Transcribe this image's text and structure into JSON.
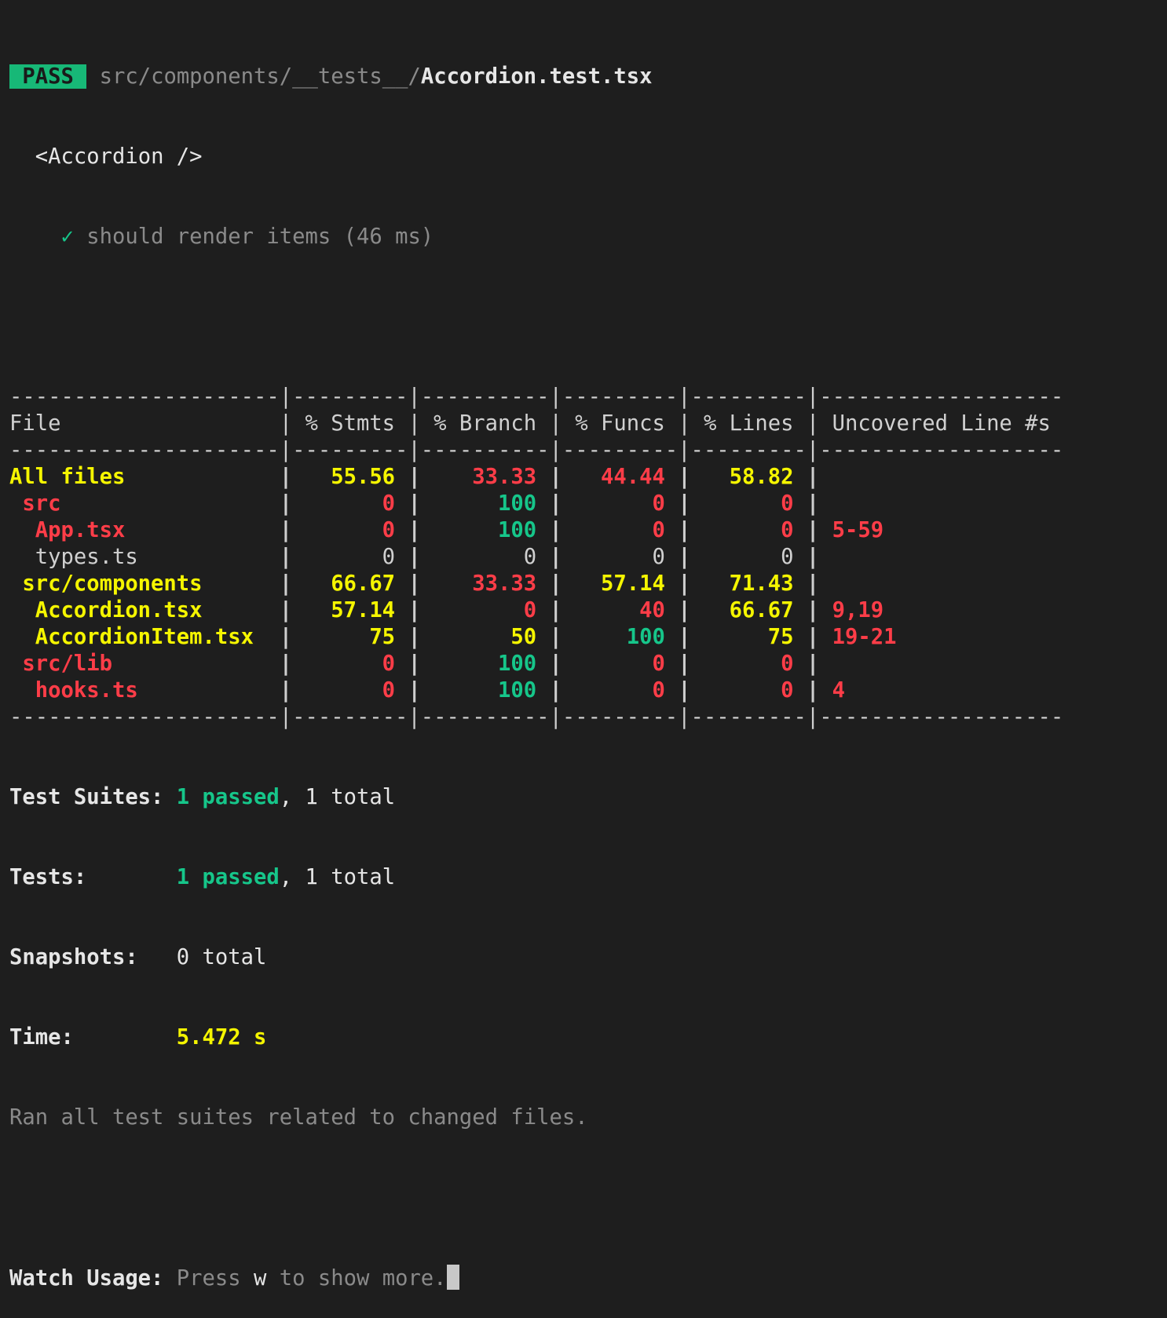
{
  "header": {
    "status_badge": "PASS",
    "test_path_dir": "src/components/__tests__/",
    "test_file": "Accordion.test.tsx",
    "describe_block": "<Accordion />",
    "check_icon": "✓",
    "test_name": "should render items (46 ms)"
  },
  "coverage": {
    "columns": [
      "File",
      "% Stmts",
      "% Branch",
      "% Funcs",
      "% Lines",
      "Uncovered Line #s"
    ],
    "rows": [
      {
        "file": "All files",
        "indent": 0,
        "file_color": "yellow",
        "stmts": "55.56",
        "stmts_color": "yellow",
        "branch": "33.33",
        "branch_color": "red",
        "funcs": "44.44",
        "funcs_color": "red",
        "lines": "58.82",
        "lines_color": "yellow",
        "uncovered": ""
      },
      {
        "file": "src",
        "indent": 1,
        "file_color": "red",
        "stmts": "0",
        "stmts_color": "red",
        "branch": "100",
        "branch_color": "green",
        "funcs": "0",
        "funcs_color": "red",
        "lines": "0",
        "lines_color": "red",
        "uncovered": ""
      },
      {
        "file": "App.tsx",
        "indent": 2,
        "file_color": "red",
        "stmts": "0",
        "stmts_color": "red",
        "branch": "100",
        "branch_color": "green",
        "funcs": "0",
        "funcs_color": "red",
        "lines": "0",
        "lines_color": "red",
        "uncovered": "5-59"
      },
      {
        "file": "types.ts",
        "indent": 2,
        "file_color": "gray",
        "stmts": "0",
        "stmts_color": "gray",
        "branch": "0",
        "branch_color": "gray",
        "funcs": "0",
        "funcs_color": "gray",
        "lines": "0",
        "lines_color": "gray",
        "uncovered": ""
      },
      {
        "file": "src/components",
        "indent": 1,
        "file_color": "yellow",
        "stmts": "66.67",
        "stmts_color": "yellow",
        "branch": "33.33",
        "branch_color": "red",
        "funcs": "57.14",
        "funcs_color": "yellow",
        "lines": "71.43",
        "lines_color": "yellow",
        "uncovered": ""
      },
      {
        "file": "Accordion.tsx",
        "indent": 2,
        "file_color": "yellow",
        "stmts": "57.14",
        "stmts_color": "yellow",
        "branch": "0",
        "branch_color": "red",
        "funcs": "40",
        "funcs_color": "red",
        "lines": "66.67",
        "lines_color": "yellow",
        "uncovered": "9,19"
      },
      {
        "file": "AccordionItem.tsx",
        "indent": 2,
        "file_color": "yellow",
        "stmts": "75",
        "stmts_color": "yellow",
        "branch": "50",
        "branch_color": "yellow",
        "funcs": "100",
        "funcs_color": "green",
        "lines": "75",
        "lines_color": "yellow",
        "uncovered": "19-21"
      },
      {
        "file": "src/lib",
        "indent": 1,
        "file_color": "red",
        "stmts": "0",
        "stmts_color": "red",
        "branch": "100",
        "branch_color": "green",
        "funcs": "0",
        "funcs_color": "red",
        "lines": "0",
        "lines_color": "red",
        "uncovered": ""
      },
      {
        "file": "hooks.ts",
        "indent": 2,
        "file_color": "red",
        "stmts": "0",
        "stmts_color": "red",
        "branch": "100",
        "branch_color": "green",
        "funcs": "0",
        "funcs_color": "red",
        "lines": "0",
        "lines_color": "red",
        "uncovered": "4"
      }
    ]
  },
  "summary": {
    "suites_label": "Test Suites:",
    "suites_passed": "1 passed",
    "suites_total": ", 1 total",
    "tests_label": "Tests:",
    "tests_passed": "1 passed",
    "tests_total": ", 1 total",
    "snapshots_label": "Snapshots:",
    "snapshots_value": "0 total",
    "time_label": "Time:",
    "time_value": "5.472 s",
    "ran_message": "Ran all test suites related to changed files."
  },
  "watch": {
    "label": "Watch Usage:",
    "press": "Press ",
    "key": "w",
    "rest": " to show more."
  }
}
